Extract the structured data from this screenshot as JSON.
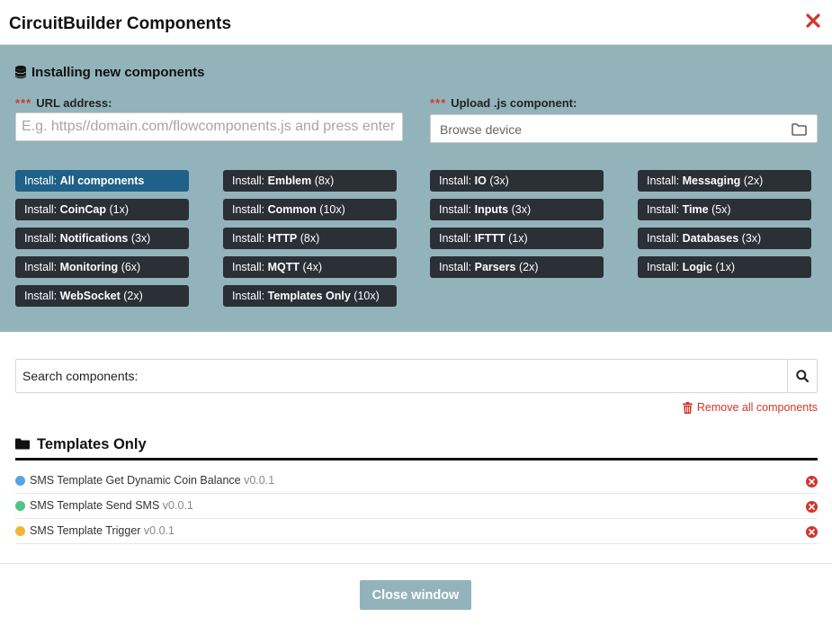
{
  "header": {
    "title": "CircuitBuilder Components"
  },
  "install": {
    "heading": "Installing new components",
    "required_mark": "***",
    "url_label": "URL address:",
    "url_placeholder": "E.g. https//domain.com/flowcomponents.js and press enter",
    "upload_label": "Upload .js component:",
    "upload_placeholder": "Browse device",
    "prefix": "Install:",
    "buttons": [
      {
        "name": "All components",
        "count": ""
      },
      {
        "name": "Emblem",
        "count": "(8x)"
      },
      {
        "name": "IO",
        "count": "(3x)"
      },
      {
        "name": "Messaging",
        "count": "(2x)"
      },
      {
        "name": "CoinCap",
        "count": "(1x)"
      },
      {
        "name": "Common",
        "count": "(10x)"
      },
      {
        "name": "Inputs",
        "count": "(3x)"
      },
      {
        "name": "Time",
        "count": "(5x)"
      },
      {
        "name": "Notifications",
        "count": "(3x)"
      },
      {
        "name": "HTTP",
        "count": "(8x)"
      },
      {
        "name": "IFTTT",
        "count": "(1x)"
      },
      {
        "name": "Databases",
        "count": "(3x)"
      },
      {
        "name": "Monitoring",
        "count": "(6x)"
      },
      {
        "name": "MQTT",
        "count": "(4x)"
      },
      {
        "name": "Parsers",
        "count": "(2x)"
      },
      {
        "name": "Logic",
        "count": "(1x)"
      },
      {
        "name": "WebSocket",
        "count": "(2x)"
      },
      {
        "name": "Templates Only",
        "count": "(10x)"
      }
    ]
  },
  "search": {
    "placeholder": "Search components:"
  },
  "remove_all_label": "Remove all components",
  "group": {
    "title": "Templates Only",
    "items": [
      {
        "name": "SMS Template Get Dynamic Coin Balance",
        "version": "v0.0.1",
        "color": "#5aa2e6"
      },
      {
        "name": "SMS Template Send SMS",
        "version": "v0.0.1",
        "color": "#4dc583"
      },
      {
        "name": "SMS Template Trigger",
        "version": "v0.0.1",
        "color": "#f2b632"
      }
    ]
  },
  "close_label": "Close window",
  "colors": {
    "panel": "#93b3bb",
    "button": "#2b2f36",
    "active": "#1f6188",
    "danger": "#d2352b"
  }
}
